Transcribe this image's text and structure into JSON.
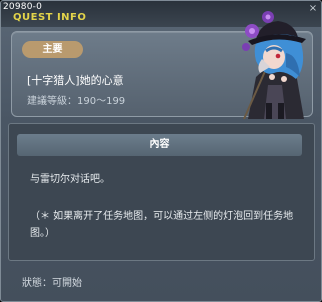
{
  "window": {
    "quest_id": "20980-0",
    "title": "QUEST INFO",
    "close_glyph": "×"
  },
  "quest": {
    "type_badge": "主要",
    "name": "[十字猎人]她的心意",
    "level_text": "建議等級：190～199"
  },
  "npc": {
    "icon": "npc-portrait"
  },
  "content": {
    "header": "內容",
    "dialog": "与雷切尔对话吧。",
    "note": "（＊ 如果离开了任务地图，可以通过左侧的灯泡回到任务地图。）"
  },
  "status": {
    "text": "狀態：可開始"
  },
  "colors": {
    "title_accent": "#e3d44a",
    "badge": "#b99a6e",
    "panel_bg": "#3d4752"
  }
}
